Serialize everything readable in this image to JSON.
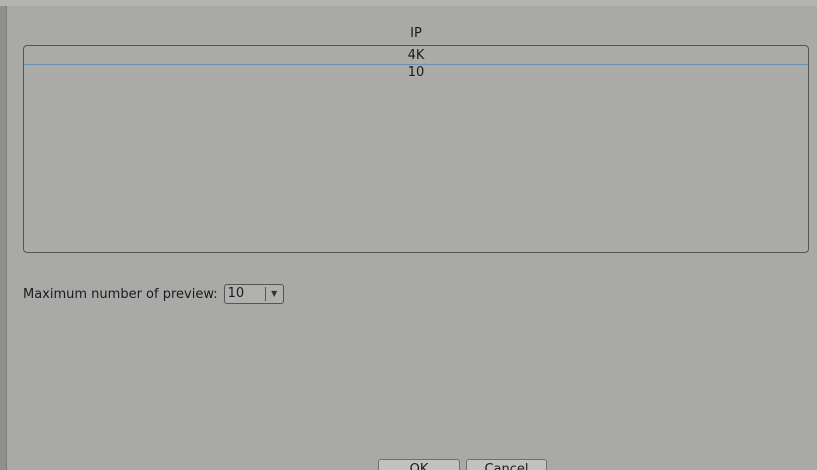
{
  "list": {
    "column_header": "IP",
    "rows": [
      "4K",
      "10"
    ]
  },
  "preview": {
    "label": "Maximum number of preview:",
    "selected_value": "10"
  },
  "buttons": {
    "ok_label": "OK",
    "cancel_label": "Cancel"
  },
  "colors": {
    "background": "#a9aaa8",
    "selection_line": "#6d8fb3",
    "border": "#555654"
  },
  "icons": {
    "dropdown": "triangle-down-icon"
  }
}
